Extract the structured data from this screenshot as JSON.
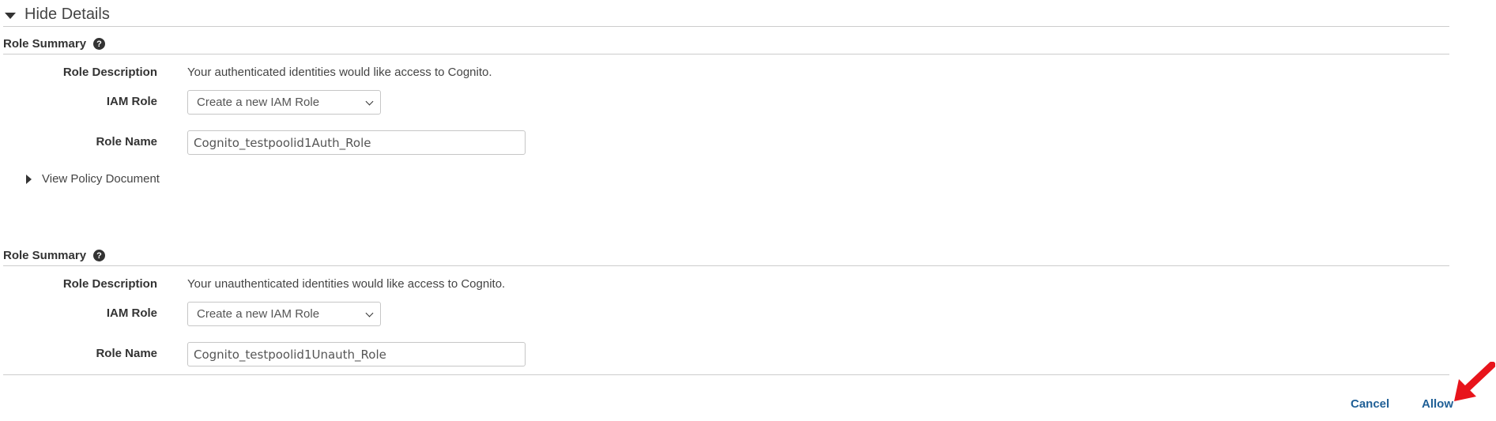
{
  "details_toggle": {
    "label": "Hide Details"
  },
  "sections": [
    {
      "title": "Role Summary",
      "role_description_label": "Role Description",
      "role_description": "Your authenticated identities would like access to Cognito.",
      "iam_role_label": "IAM Role",
      "iam_role_selected": "Create a new IAM Role",
      "role_name_label": "Role Name",
      "role_name_value": "Cognito_testpoolid1Auth_Role",
      "policy_toggle_label": "View Policy Document"
    },
    {
      "title": "Role Summary",
      "role_description_label": "Role Description",
      "role_description": "Your unauthenticated identities would like access to Cognito.",
      "iam_role_label": "IAM Role",
      "iam_role_selected": "Create a new IAM Role",
      "role_name_label": "Role Name",
      "role_name_value": "Cognito_testpoolid1Unauth_Role"
    }
  ],
  "actions": {
    "cancel_label": "Cancel",
    "allow_label": "Allow"
  },
  "colors": {
    "link": "#1f5f96",
    "annotation_arrow": "#e8141b"
  }
}
